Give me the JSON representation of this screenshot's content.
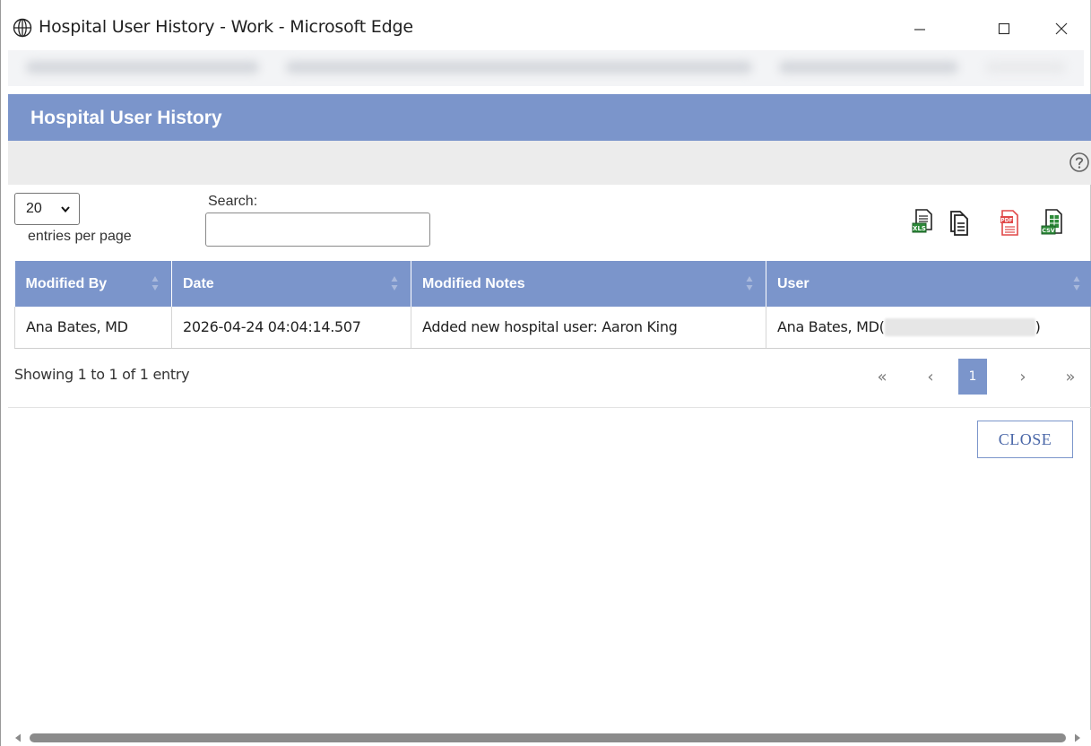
{
  "window": {
    "title": "Hospital User History - Work - Microsoft Edge",
    "controls": {
      "minimize": "minimize-icon",
      "maximize": "maximize-icon",
      "close": "close-icon"
    }
  },
  "header": {
    "title": "Hospital User History"
  },
  "controls": {
    "page_length": "20",
    "page_length_label": "entries per page",
    "search_label": "Search:",
    "search_value": "",
    "export_icons": [
      "excel-export-icon",
      "copy-icon",
      "pdf-export-icon",
      "csv-export-icon"
    ]
  },
  "table": {
    "columns": [
      "Modified By",
      "Date",
      "Modified Notes",
      "User"
    ],
    "rows": [
      {
        "modified_by": "Ana Bates, MD",
        "date": "2026-04-24 04:04:14.507",
        "notes": "Added new hospital user: Aaron King",
        "user_prefix": "Ana Bates, MD(",
        "user_suffix": ")"
      }
    ]
  },
  "footer": {
    "info": "Showing 1 to 1 of 1 entry",
    "pagination": {
      "first": "«",
      "prev": "‹",
      "current": "1",
      "next": "›",
      "last": "»"
    },
    "close_label": "CLOSE"
  },
  "colors": {
    "accent": "#7b95cb",
    "band": "#ececec",
    "pdf_red": "#e04848",
    "excel_green": "#2e8b3a"
  }
}
